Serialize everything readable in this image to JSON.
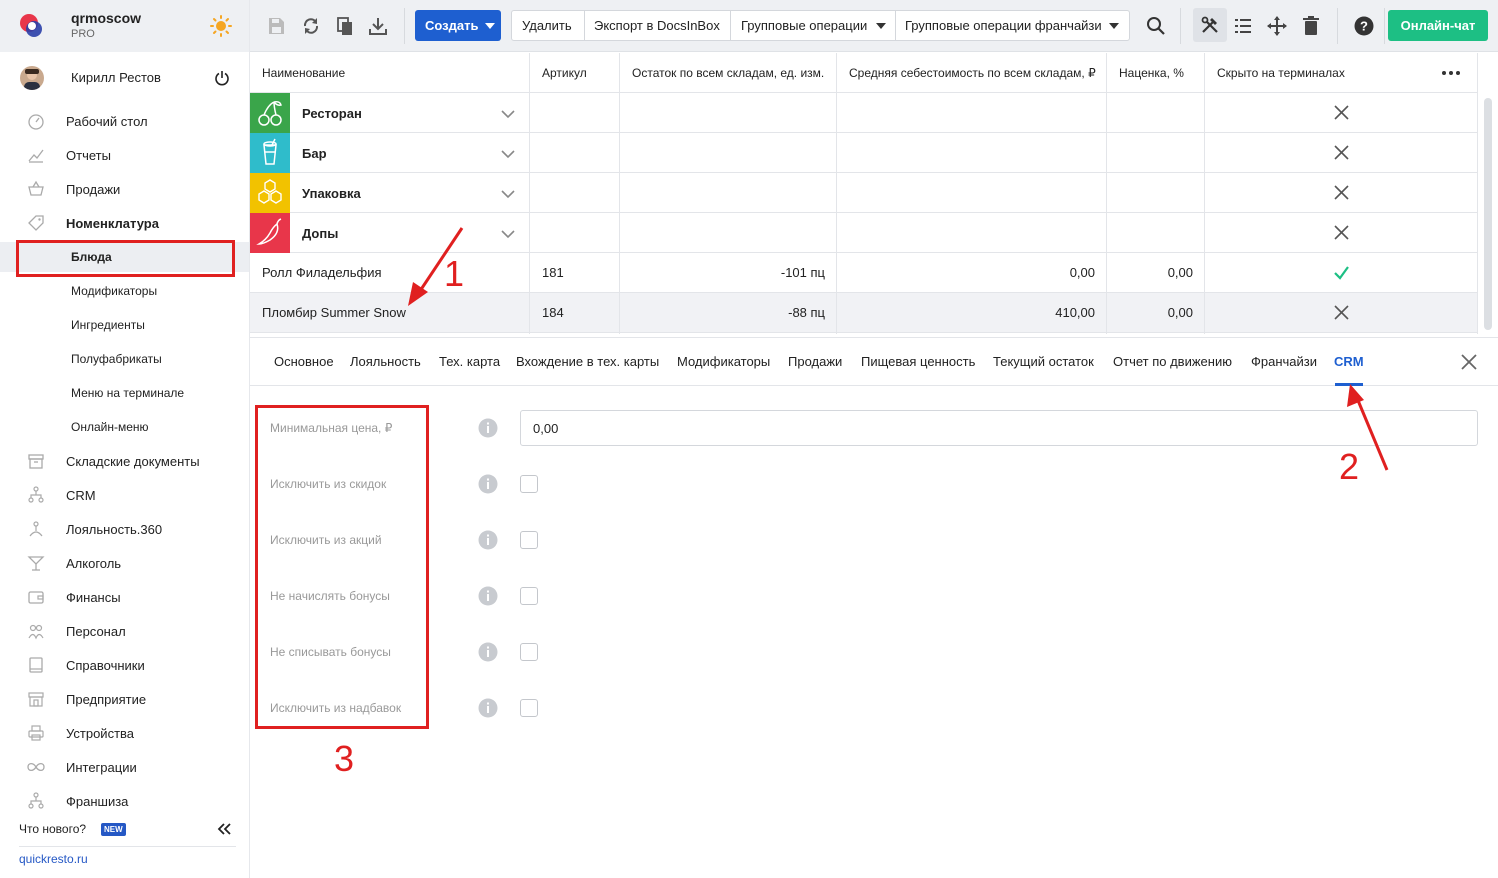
{
  "brand": {
    "name": "qrmoscow",
    "plan": "PRO"
  },
  "user": {
    "name": "Кирилл Рестов"
  },
  "sidebar": {
    "items": [
      {
        "label": "Рабочий стол",
        "icon": "dashboard-icon"
      },
      {
        "label": "Отчеты",
        "icon": "chart-icon"
      },
      {
        "label": "Продажи",
        "icon": "basket-icon"
      },
      {
        "label": "Номенклатура",
        "icon": "tag-icon",
        "bold": true
      },
      {
        "label": "Складские документы",
        "icon": "archive-icon"
      },
      {
        "label": "CRM",
        "icon": "hierarchy-icon"
      },
      {
        "label": "Лояльность.360",
        "icon": "loyalty-icon"
      },
      {
        "label": "Алкоголь",
        "icon": "cocktail-icon"
      },
      {
        "label": "Финансы",
        "icon": "wallet-icon"
      },
      {
        "label": "Персонал",
        "icon": "people-icon"
      },
      {
        "label": "Справочники",
        "icon": "book-icon"
      },
      {
        "label": "Предприятие",
        "icon": "store-icon"
      },
      {
        "label": "Устройства",
        "icon": "printer-icon"
      },
      {
        "label": "Интеграции",
        "icon": "infinity-icon"
      },
      {
        "label": "Франшиза",
        "icon": "hierarchy-icon"
      }
    ],
    "subitems": [
      {
        "label": "Блюда",
        "active": true
      },
      {
        "label": "Модификаторы"
      },
      {
        "label": "Ингредиенты"
      },
      {
        "label": "Полуфабрикаты"
      },
      {
        "label": "Меню на терминале"
      },
      {
        "label": "Онлайн-меню"
      }
    ],
    "whats_new": "Что нового?",
    "new_badge": "NEW",
    "site_link": "quickresto.ru"
  },
  "toolbar": {
    "create_label": "Создать",
    "delete_label": "Удалить",
    "export_label": "Экспорт в DocsInBox",
    "group_ops_label": "Групповые операции",
    "group_ops_franchise_label": "Групповые операции франчайзи",
    "chat_label": "Онлайн-чат"
  },
  "table": {
    "headers": [
      "Наименование",
      "Артикул",
      "Остаток по всем складам, ед. изм.",
      "Средняя себестоимость по всем складам, ₽",
      "Наценка, %",
      "Скрыто на терминалах"
    ],
    "groups": [
      {
        "name": "Ресторан",
        "color": "#3aa54a",
        "icon": "cherries-icon"
      },
      {
        "name": "Бар",
        "color": "#2fbccb",
        "icon": "cocktail-glass-icon"
      },
      {
        "name": "Упаковка",
        "color": "#f2c200",
        "icon": "honeycomb-icon"
      },
      {
        "name": "Допы",
        "color": "#e8364a",
        "icon": "chili-icon"
      }
    ],
    "rows": [
      {
        "name": "Ролл Филадельфия",
        "article": "181",
        "stock": "-101 пц",
        "cost": "0,00",
        "markup": "0,00",
        "hidden": "check"
      },
      {
        "name": "Пломбир Summer Snow",
        "article": "184",
        "stock": "-88 пц",
        "cost": "410,00",
        "markup": "0,00",
        "hidden": "cross"
      }
    ]
  },
  "tabs": [
    "Основное",
    "Лояльность",
    "Тех. карта",
    "Вхождение в тех. карты",
    "Модификаторы",
    "Продажи",
    "Пищевая ценность",
    "Текущий остаток",
    "Отчет по движению",
    "Франчайзи",
    "CRM"
  ],
  "active_tab": "CRM",
  "form": {
    "fields": [
      {
        "label": "Минимальная цена, ₽",
        "type": "input",
        "value": "0,00"
      },
      {
        "label": "Исключить из скидок",
        "type": "checkbox",
        "checked": false
      },
      {
        "label": "Исключить из акций",
        "type": "checkbox",
        "checked": false
      },
      {
        "label": "Не начислять бонусы",
        "type": "checkbox",
        "checked": false
      },
      {
        "label": "Не списывать бонусы",
        "type": "checkbox",
        "checked": false
      },
      {
        "label": "Исключить из надбавок",
        "type": "checkbox",
        "checked": false
      }
    ]
  },
  "annotations": [
    "1",
    "2",
    "3"
  ],
  "colors": {
    "accent": "#1e5fd0",
    "chat": "#1dbf84",
    "annotation": "#e02020"
  }
}
